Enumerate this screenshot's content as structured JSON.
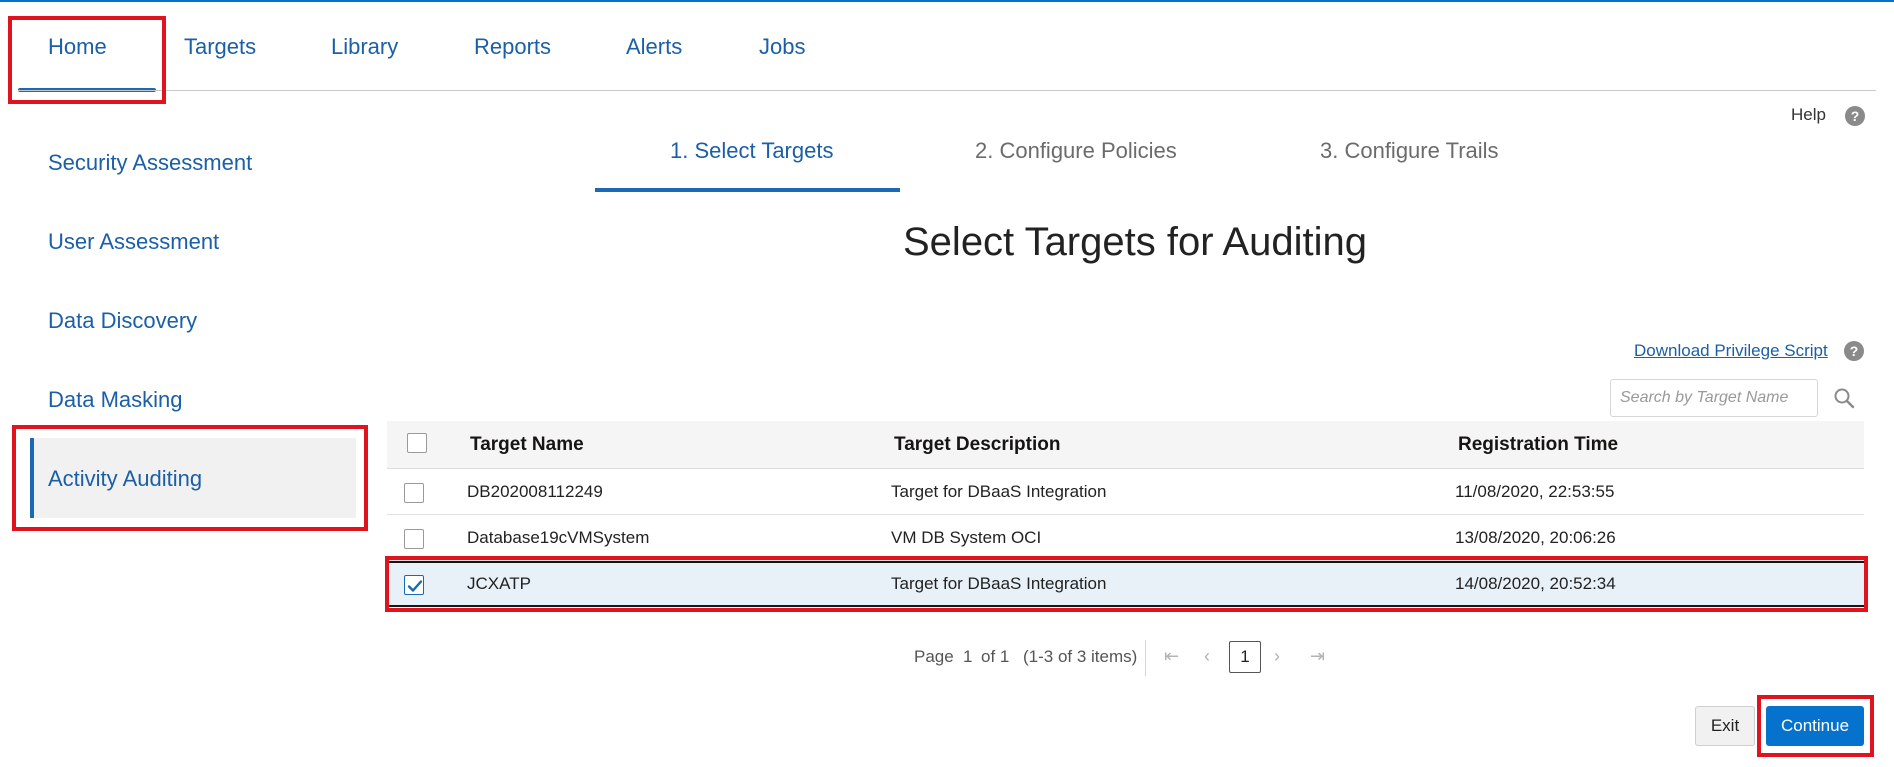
{
  "topnav": {
    "items": [
      {
        "label": "Home"
      },
      {
        "label": "Targets"
      },
      {
        "label": "Library"
      },
      {
        "label": "Reports"
      },
      {
        "label": "Alerts"
      },
      {
        "label": "Jobs"
      }
    ],
    "active": "Home"
  },
  "help": {
    "label": "Help",
    "icon": "question-circle-icon"
  },
  "sidebar": {
    "items": [
      {
        "label": "Security Assessment"
      },
      {
        "label": "User Assessment"
      },
      {
        "label": "Data Discovery"
      },
      {
        "label": "Data Masking"
      },
      {
        "label": "Activity Auditing"
      }
    ],
    "active": "Activity Auditing"
  },
  "wizard": {
    "steps": [
      {
        "label": "1. Select Targets"
      },
      {
        "label": "2. Configure Policies"
      },
      {
        "label": "3. Configure Trails"
      }
    ],
    "active_step": 1
  },
  "page_title": "Select Targets for Auditing",
  "download_link": "Download Privilege Script",
  "search": {
    "placeholder": "Search by Target Name",
    "value": "",
    "icon": "search-icon"
  },
  "table": {
    "columns": [
      "Target Name",
      "Target Description",
      "Registration Time"
    ],
    "rows": [
      {
        "name": "DB202008112249",
        "description": "Target for DBaaS Integration",
        "time": "11/08/2020, 22:53:55",
        "checked": false
      },
      {
        "name": "Database19cVMSystem",
        "description": "VM DB System OCI",
        "time": "13/08/2020, 20:06:26",
        "checked": false
      },
      {
        "name": "JCXATP",
        "description": "Target for DBaaS Integration",
        "time": "14/08/2020, 20:52:34",
        "checked": true
      }
    ]
  },
  "pagination": {
    "page_label": "Page",
    "current_page": "1",
    "of_label": "of 1",
    "items_label": "(1-3 of 3 items)",
    "page_button": "1"
  },
  "buttons": {
    "exit": "Exit",
    "continue": "Continue"
  },
  "colors": {
    "accent": "#0572ce",
    "link": "#1b5fa6",
    "highlight": "#e0141e"
  }
}
